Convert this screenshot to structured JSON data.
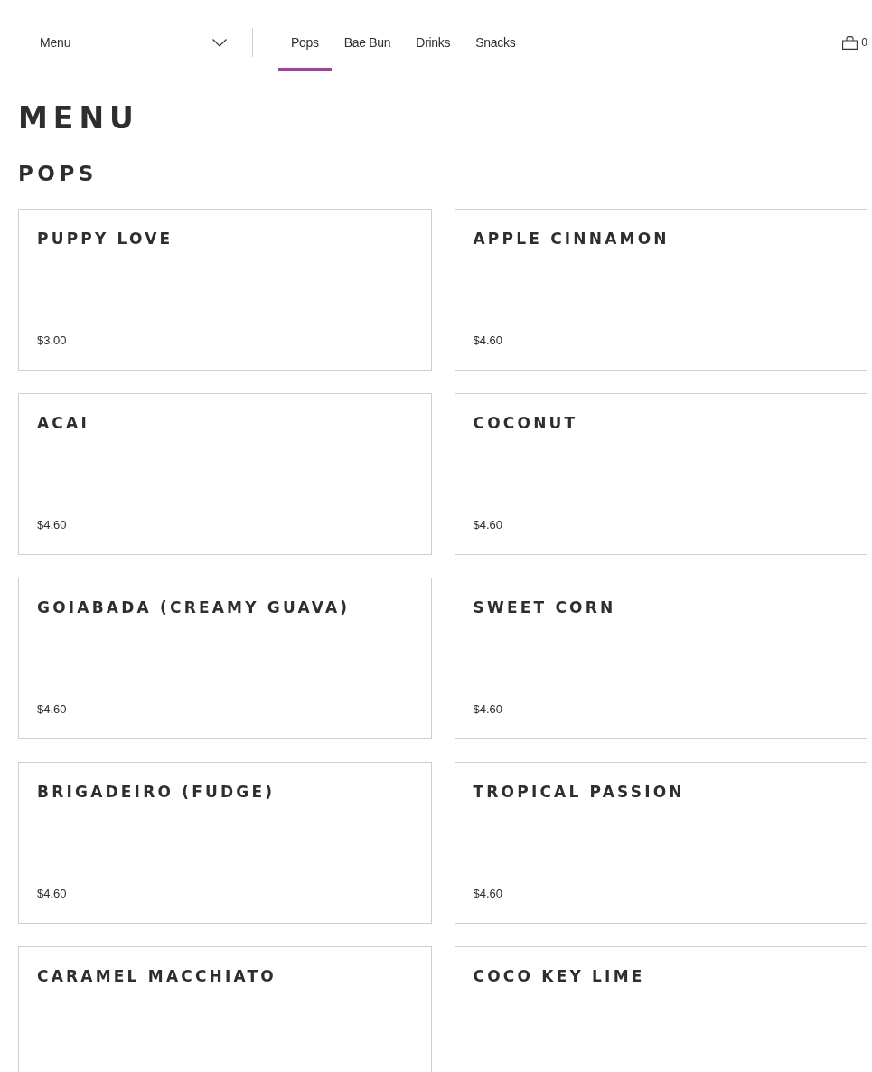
{
  "nav": {
    "dropdown": {
      "label": "Menu"
    },
    "tabs": [
      {
        "label": "Pops",
        "selected": true
      },
      {
        "label": "Bae Bun",
        "selected": false
      },
      {
        "label": "Drinks",
        "selected": false
      },
      {
        "label": "Snacks",
        "selected": false
      }
    ],
    "cart": {
      "count": "0"
    }
  },
  "page": {
    "title": "MENU"
  },
  "section": {
    "title": "POPS",
    "items": [
      {
        "name": "PUPPY LOVE",
        "price": "$3.00"
      },
      {
        "name": "APPLE CINNAMON",
        "price": "$4.60"
      },
      {
        "name": "ACAI",
        "price": "$4.60"
      },
      {
        "name": "COCONUT",
        "price": "$4.60"
      },
      {
        "name": "GOIABADA (CREAMY GUAVA)",
        "price": "$4.60"
      },
      {
        "name": "SWEET CORN",
        "price": "$4.60"
      },
      {
        "name": "BRIGADEIRO (FUDGE)",
        "price": "$4.60"
      },
      {
        "name": "TROPICAL PASSION",
        "price": "$4.60"
      },
      {
        "name": "CARAMEL MACCHIATO"
      },
      {
        "name": "COCO KEY LIME"
      }
    ]
  }
}
